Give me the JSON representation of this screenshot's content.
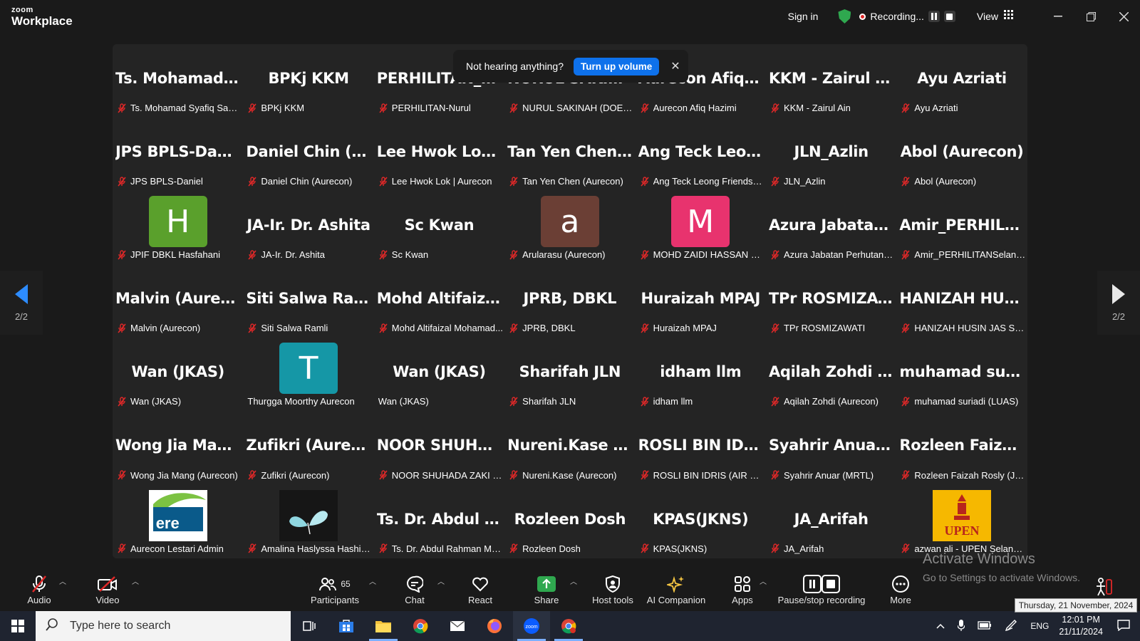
{
  "app": {
    "logo_top": "zoom",
    "logo_bottom": "Workplace"
  },
  "titlebar": {
    "sign_in": "Sign in",
    "recording": "Recording...",
    "view": "View"
  },
  "toast": {
    "message": "Not hearing anything?",
    "button": "Turn up volume"
  },
  "pager": {
    "left": "2/2",
    "right": "2/2"
  },
  "tiles": [
    {
      "big": "Ts. Mohamad Sy...",
      "name": "Ts. Mohamad Syafiq Sam..."
    },
    {
      "big": "BPKj KKM",
      "name": "BPKj KKM"
    },
    {
      "big": "PERHILITAN_Nu...",
      "name": "PERHILITAN-Nurul"
    },
    {
      "big": "NURUL SAKINA...",
      "name": "NURUL SAKINAH (DOE-H..."
    },
    {
      "big": "Aurecon Afiq H...",
      "name": "Aurecon Afiq Hazimi"
    },
    {
      "big": "KKM - Zairul Ain",
      "name": "KKM - Zairul Ain"
    },
    {
      "big": "Ayu Azriati",
      "name": "Ayu Azriati"
    },
    {
      "big": "JPS BPLS-Daniel",
      "name": "JPS BPLS-Daniel"
    },
    {
      "big": "Daniel Chin (Au...",
      "name": "Daniel Chin (Aurecon)"
    },
    {
      "big": "Lee Hwok Lok |...",
      "name": "Lee Hwok Lok | Aurecon"
    },
    {
      "big": "Tan Yen Chen (A...",
      "name": "Tan Yen Chen (Aurecon)"
    },
    {
      "big": "Ang Teck Leong...",
      "name": "Ang Teck Leong Friends o..."
    },
    {
      "big": "JLN_Azlin",
      "name": "JLN_Azlin"
    },
    {
      "big": "Abol (Aurecon)",
      "name": "Abol (Aurecon)"
    },
    {
      "avatar": "H",
      "avatar_color": "#5aa02c",
      "name": "JPIF DBKL Hasfahani"
    },
    {
      "big": "JA-Ir. Dr. Ashita",
      "name": "JA-Ir. Dr. Ashita"
    },
    {
      "big": "Sc Kwan",
      "name": "Sc Kwan"
    },
    {
      "avatar": "a",
      "avatar_color": "#6b3f35",
      "name": "Arularasu (Aurecon)"
    },
    {
      "avatar": "M",
      "avatar_color": "#e8336e",
      "name": "MOHD ZAIDI HASSAN @ ..."
    },
    {
      "big": "Azura Jabatan P...",
      "name": "Azura Jabatan Perhutana..."
    },
    {
      "big": "Amir_PERHILIT...",
      "name": "Amir_PERHILITANSelangor"
    },
    {
      "big": "Malvin (Aurecon)",
      "name": "Malvin (Aurecon)"
    },
    {
      "big": "Siti Salwa Ramli",
      "name": "Siti Salwa Ramli"
    },
    {
      "big": "Mohd  Altifaizal...",
      "name": "Mohd Altifaizal Mohamad..."
    },
    {
      "big": "JPRB, DBKL",
      "name": "JPRB, DBKL"
    },
    {
      "big": "Huraizah MPAJ",
      "name": "Huraizah MPAJ"
    },
    {
      "big": "TPr ROSMIZAW...",
      "name": "TPr ROSMIZAWATI"
    },
    {
      "big": "HANIZAH HUSI...",
      "name": "HANIZAH HUSIN JAS SEL..."
    },
    {
      "big": "Wan (JKAS)",
      "name": "Wan (JKAS)"
    },
    {
      "avatar": "T",
      "avatar_color": "#1597a6",
      "name": "Thurgga Moorthy Aurecon",
      "nomic": true
    },
    {
      "big": "Wan (JKAS)",
      "name": "Wan (JKAS)",
      "nomic": true
    },
    {
      "big": "Sharifah JLN",
      "name": "Sharifah JLN"
    },
    {
      "big": "idham llm",
      "name": "idham llm"
    },
    {
      "big": "Aqilah Zohdi (A...",
      "name": "Aqilah Zohdi (Aurecon)"
    },
    {
      "big": "muhamad  suria...",
      "name": "muhamad suriadi (LUAS)"
    },
    {
      "big": "Wong Jia Mang...",
      "name": "Wong Jia Mang (Aurecon)"
    },
    {
      "big": "Zufikri (Aurecon)",
      "name": "Zufikri (Aurecon)"
    },
    {
      "big": "NOOR SHUHAD...",
      "name": "NOOR SHUHADA ZAKI (B..."
    },
    {
      "big": "Nureni.Kase (Au...",
      "name": "Nureni.Kase (Aurecon)"
    },
    {
      "big": "ROSLI BIN IDRI...",
      "name": "ROSLI BIN IDRIS (AIR SEL..."
    },
    {
      "big": "Syahrir Anuar (...",
      "name": "Syahrir Anuar (MRTL)"
    },
    {
      "big": "Rozleen Faizah...",
      "name": "Rozleen Faizah Rosly (JKK..."
    },
    {
      "image": "ere-logo",
      "image_text": "ere",
      "name": "Aurecon Lestari Admin"
    },
    {
      "image": "butterfly",
      "name": "Amalina Haslyssa Hashim..."
    },
    {
      "big": "Ts. Dr. Abdul Ra...",
      "name": "Ts. Dr. Abdul Rahman Ma..."
    },
    {
      "big": "Rozleen Dosh",
      "name": "Rozleen Dosh"
    },
    {
      "big": "KPAS(JKNS)",
      "name": "KPAS(JKNS)"
    },
    {
      "big": "JA_Arifah",
      "name": "JA_Arifah"
    },
    {
      "image": "upen-logo",
      "image_text": "UPEN",
      "name": "azwan ali - UPEN Selangor"
    }
  ],
  "toolbar": {
    "audio": "Audio",
    "video": "Video",
    "participants": "Participants",
    "participants_count": "65",
    "chat": "Chat",
    "react": "React",
    "share": "Share",
    "host_tools": "Host tools",
    "ai_companion": "AI Companion",
    "apps": "Apps",
    "pause_stop": "Pause/stop recording",
    "more": "More"
  },
  "watermark": {
    "line1": "Activate Windows",
    "line2": "Go to Settings to activate Windows."
  },
  "tooltip": "Thursday, 21 November, 2024",
  "taskbar": {
    "search_placeholder": "Type here to search",
    "lang": "ENG",
    "time": "12:01 PM",
    "date": "21/11/2024"
  },
  "colors": {
    "accent": "#2d8cff",
    "mic_off": "#e02828",
    "share": "#2fa84f"
  }
}
